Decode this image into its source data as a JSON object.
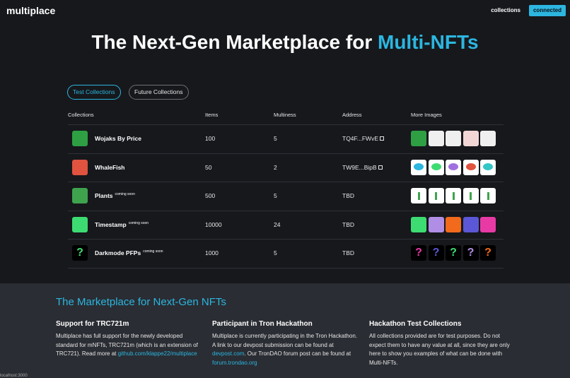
{
  "nav": {
    "brand": "multiplace",
    "collections_link": "collections",
    "connected_button": "connected"
  },
  "hero": {
    "title_prefix": "The Next-Gen Marketplace for ",
    "title_accent": "Multi-NFTs"
  },
  "tabs": [
    {
      "label": "Test Collections"
    },
    {
      "label": "Future Collections"
    }
  ],
  "table": {
    "headers": [
      "Collections",
      "Items",
      "Multiness",
      "Address",
      "More Images"
    ],
    "rows": [
      {
        "name": "Wojaks By Price",
        "badge": "",
        "items": "100",
        "multiness": "5",
        "address": "TQ4F...FWvE",
        "thumb_color": "#2ea043",
        "images": [
          {
            "icon": "green-wojak"
          },
          {
            "icon": "wojak-sketch"
          },
          {
            "icon": "wojak-sketch"
          },
          {
            "icon": "wojak-red"
          },
          {
            "icon": "wojak-sketch"
          }
        ]
      },
      {
        "name": "WhaleFish",
        "badge": "",
        "items": "50",
        "multiness": "2",
        "address": "TW9E...BipB",
        "thumb_color": "#e0533f",
        "images": [
          {
            "icon": "whale-blue"
          },
          {
            "icon": "whale-green"
          },
          {
            "icon": "whale-purple"
          },
          {
            "icon": "whale-red"
          },
          {
            "icon": "whale-teal"
          }
        ]
      },
      {
        "name": "Plants",
        "badge": "coming soon",
        "items": "500",
        "multiness": "5",
        "address": "TBD",
        "thumb_color": "#3fa34d",
        "images": [
          {
            "icon": "plant-seed"
          },
          {
            "icon": "plant-sprout"
          },
          {
            "icon": "plant-small"
          },
          {
            "icon": "plant-grown"
          },
          {
            "icon": "plant-flower"
          }
        ]
      },
      {
        "name": "Timestamp",
        "badge": "coming soon",
        "items": "10000",
        "multiness": "24",
        "address": "TBD",
        "thumb_color": "#3ddc72",
        "images": [
          {
            "icon": "swatch-green",
            "color": "#3ddc72"
          },
          {
            "icon": "swatch-lavender",
            "color": "#b08ee6"
          },
          {
            "icon": "swatch-orange",
            "color": "#f26a1b"
          },
          {
            "icon": "swatch-indigo",
            "color": "#5b57d6"
          },
          {
            "icon": "swatch-pink",
            "color": "#e83aa5"
          }
        ]
      },
      {
        "name": "Darkmode PFPs",
        "badge": "coming soon",
        "items": "1000",
        "multiness": "5",
        "address": "TBD",
        "thumb_color": "#3ddc72",
        "images": [
          {
            "icon": "question-pink",
            "color": "#e83aa5"
          },
          {
            "icon": "question-indigo",
            "color": "#5b57d6"
          },
          {
            "icon": "question-green",
            "color": "#3ddc72"
          },
          {
            "icon": "question-lavender",
            "color": "#b08ee6"
          },
          {
            "icon": "question-orange",
            "color": "#f26a1b"
          }
        ]
      }
    ]
  },
  "footer": {
    "title": "The Marketplace for Next-Gen NFTs",
    "columns": [
      {
        "heading": "Support for TRC721m",
        "text_before": "Multiplace has full support for the newly developed standard for mNFTs, TRC721m (which is an extension of TRC721). Read more at ",
        "link1": "github.com/klappe22/multiplace",
        "text_middle": "",
        "link2": ""
      },
      {
        "heading": "Participant in Tron Hackathon",
        "text_before": "Multiplace is currently participating in the Tron Hackathon. A link to our devpost submission can be found at ",
        "link1": "devpost.com",
        "text_middle": ". Our TronDAO forum post can be found at ",
        "link2": "forum.trondao.org"
      },
      {
        "heading": "Hackathon Test Collections",
        "text_before": "All collections provided are for test purposes. Do not expect them to have any value at all, since they are only here to show you examples of what can be done with Multi-NFTs.",
        "link1": "",
        "text_middle": "",
        "link2": ""
      }
    ]
  },
  "status": {
    "url": "localhost:3000"
  },
  "colors": {
    "accent": "#2cb6e0",
    "background": "#16181c",
    "footer_bg": "#2a2d33"
  }
}
